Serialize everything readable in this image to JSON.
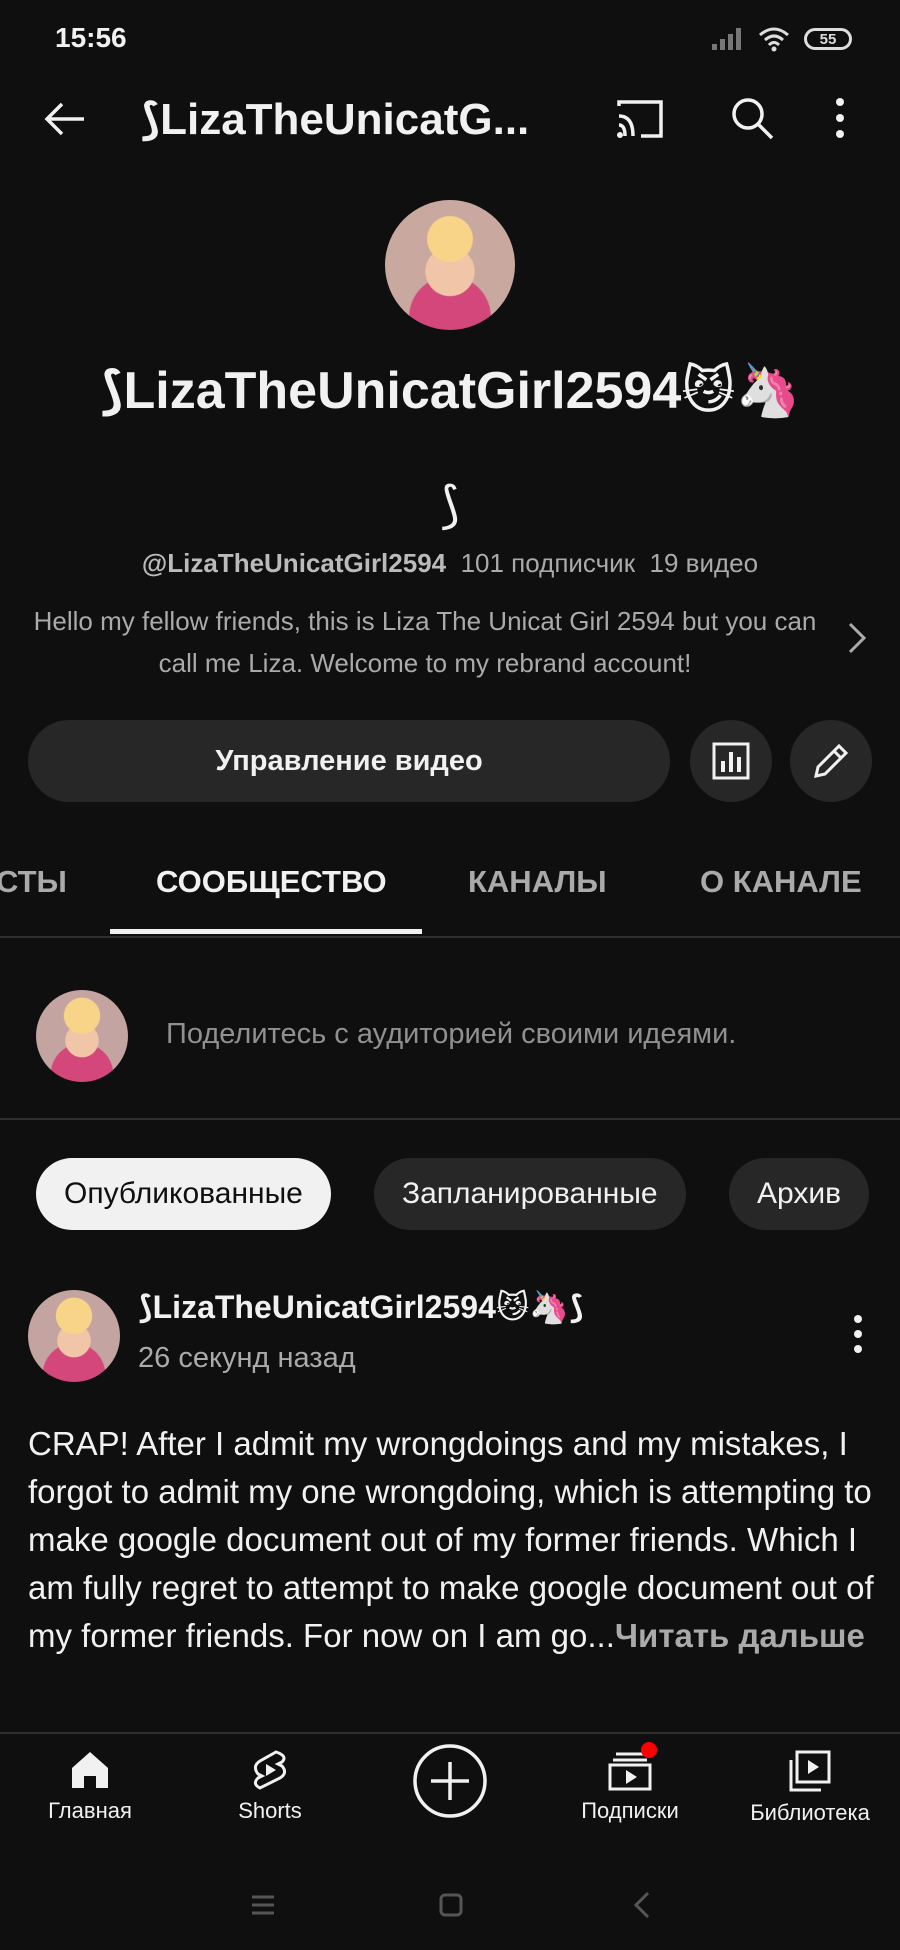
{
  "status_bar": {
    "time": "15:56",
    "battery": "55"
  },
  "app_bar": {
    "title": "LizaTheUnicatG..."
  },
  "channel": {
    "name": "LizaTheUnicatGirl2594",
    "name_emoji": "😼🦄",
    "handle": "@LizaTheUnicatGirl2594",
    "subscribers": "101 подписчик",
    "videos": "19 видео",
    "description": "Hello my fellow friends, this is Liza The Unicat Girl 2594 but you can call me Liza. Welcome to my rebrand account!"
  },
  "actions": {
    "manage_label": "Управление видео"
  },
  "tabs": [
    {
      "label": "СТЫ"
    },
    {
      "label": "СООБЩЕСТВО"
    },
    {
      "label": "КАНАЛЫ"
    },
    {
      "label": "О КАНАЛЕ"
    }
  ],
  "compose": {
    "placeholder": "Поделитесь с аудиторией своими идеями."
  },
  "filters": [
    {
      "label": "Опубликованные"
    },
    {
      "label": "Запланированные"
    },
    {
      "label": "Архив"
    }
  ],
  "post": {
    "author": "LizaTheUnicatGirl2594",
    "author_emoji": "😼🦄",
    "time": "26 секунд назад",
    "body": "CRAP! After I admit my wrongdoings and my mistakes, I forgot to admit my one wrongdoing, which is attempting to make google document out of my former friends. Which I am fully regret to attempt to make google document out of my former friends. For now on I am go...",
    "read_more": "Читать дальше"
  },
  "bottom_nav": [
    {
      "label": "Главная",
      "icon": "home-icon"
    },
    {
      "label": "Shorts",
      "icon": "shorts-icon"
    },
    {
      "label": "",
      "icon": "create-icon"
    },
    {
      "label": "Подписки",
      "icon": "subscriptions-icon"
    },
    {
      "label": "Библиотека",
      "icon": "library-icon"
    }
  ],
  "colors": {
    "background": "#0f0f0f",
    "surface": "#272727",
    "accent_red": "#ff0000"
  }
}
